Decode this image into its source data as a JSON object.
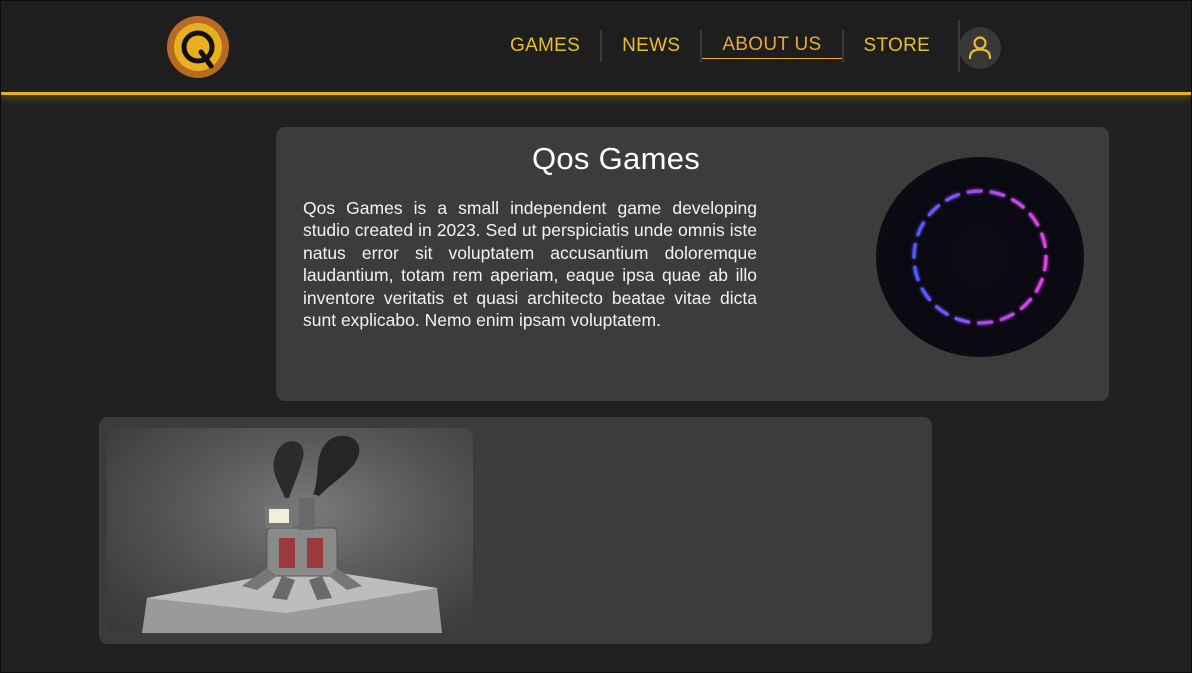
{
  "header": {
    "logo_letter": "Q",
    "logo_icon": "qos-logo-icon",
    "nav": [
      {
        "label": "GAMES",
        "active": false
      },
      {
        "label": "NEWS",
        "active": false
      },
      {
        "label": "ABOUT US",
        "active": true
      },
      {
        "label": "STORE",
        "active": false
      }
    ],
    "user_icon": "user-icon"
  },
  "about": {
    "title": "Qos Games",
    "text": "Qos Games is a small independent game developing studio created in 2023. Sed ut perspiciatis unde omnis iste natus error sit voluptatem accusantium doloremque laudantium, totam rem aperiam, eaque ipsa quae ab illo inventore veritatis et quasi architecto beatae vitae dicta sunt explicabo. Nemo enim ipsam voluptatem."
  },
  "colors": {
    "accent": "#e3b417",
    "nav_text": "#e8bf2c",
    "active_nav": "#e8a83a",
    "card": "#3c3c3c",
    "background": "#212121",
    "orb_ring_start": "#4b5bff",
    "orb_ring_end": "#e040e8"
  }
}
